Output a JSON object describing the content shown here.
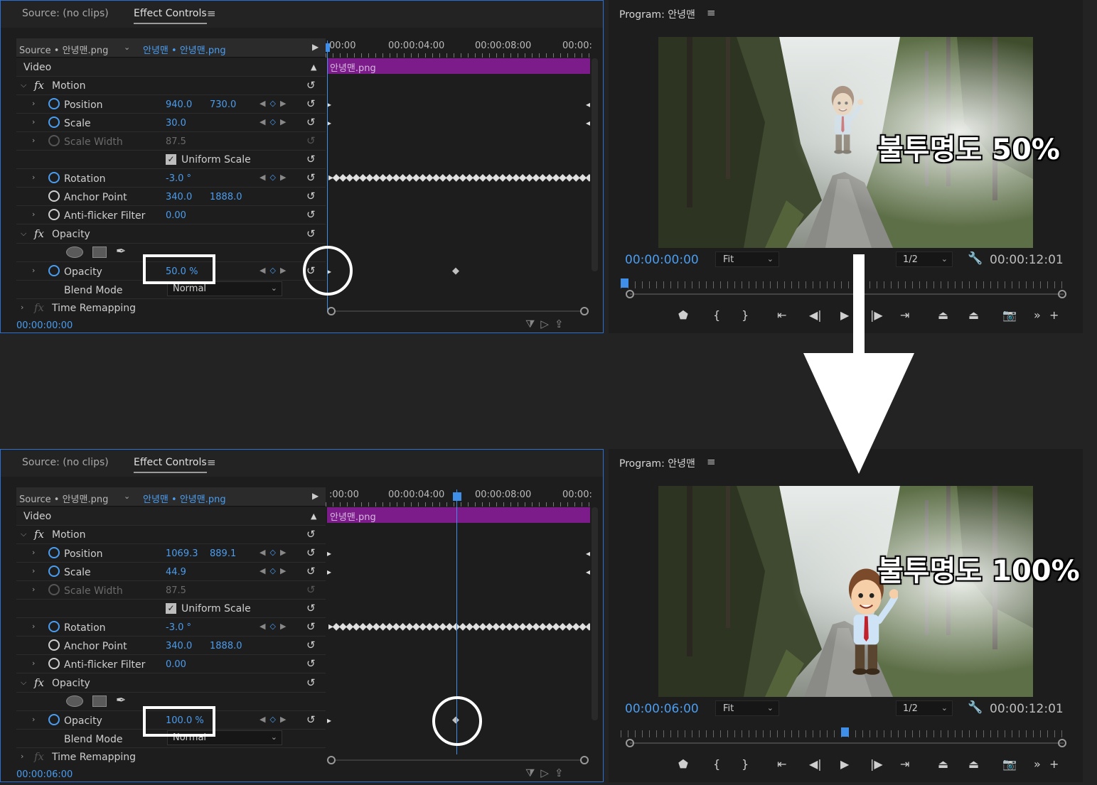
{
  "panels": [
    {
      "tabs": {
        "source": "Source: (no clips)",
        "effect_controls": "Effect Controls",
        "menu": "≡"
      },
      "header": {
        "source": "Source • 안녕맨.png",
        "clip": "안녕맨 • 안녕맨.png"
      },
      "ruler": [
        "00:00",
        "00:00:04:00",
        "00:00:08:00",
        "00:00:"
      ],
      "clip_name": "안녕맨.png",
      "video_label": "Video",
      "motion_label": "Motion",
      "position": {
        "label": "Position",
        "x": "940.0",
        "y": "730.0"
      },
      "scale": {
        "label": "Scale",
        "value": "30.0"
      },
      "scale_width": {
        "label": "Scale Width",
        "value": "87.5"
      },
      "uniform_scale": "Uniform Scale",
      "rotation": {
        "label": "Rotation",
        "value": "-3.0 °"
      },
      "anchor": {
        "label": "Anchor Point",
        "x": "340.0",
        "y": "1888.0"
      },
      "antiflicker": {
        "label": "Anti-flicker Filter",
        "value": "0.00"
      },
      "opacity_section": "Opacity",
      "opacity": {
        "label": "Opacity",
        "value": "50.0 %"
      },
      "blend": {
        "label": "Blend Mode",
        "value": "Normal"
      },
      "time_remap": "Time Remapping",
      "timecode": "00:00:00:00",
      "program": {
        "title": "Program: 안녕맨",
        "timecode": "00:00:00:00",
        "fit": "Fit",
        "resolution": "1/2",
        "duration": "00:00:12:01",
        "overlay": "불투명도 50%",
        "character_opacity": 0.5,
        "playhead_fraction": 0.0
      }
    },
    {
      "tabs": {
        "source": "Source: (no clips)",
        "effect_controls": "Effect Controls",
        "menu": "≡"
      },
      "header": {
        "source": "Source • 안녕맨.png",
        "clip": "안녕맨 • 안녕맨.png"
      },
      "ruler": [
        ":00:00",
        "00:00:04:00",
        "00:00:08:00",
        "00:00:"
      ],
      "clip_name": "안녕맨.png",
      "video_label": "Video",
      "motion_label": "Motion",
      "position": {
        "label": "Position",
        "x": "1069.3",
        "y": "889.1"
      },
      "scale": {
        "label": "Scale",
        "value": "44.9"
      },
      "scale_width": {
        "label": "Scale Width",
        "value": "87.5"
      },
      "uniform_scale": "Uniform Scale",
      "rotation": {
        "label": "Rotation",
        "value": "-3.0 °"
      },
      "anchor": {
        "label": "Anchor Point",
        "x": "340.0",
        "y": "1888.0"
      },
      "antiflicker": {
        "label": "Anti-flicker Filter",
        "value": "0.00"
      },
      "opacity_section": "Opacity",
      "opacity": {
        "label": "Opacity",
        "value": "100.0 %"
      },
      "blend": {
        "label": "Blend Mode",
        "value": "Normal"
      },
      "time_remap": "Time Remapping",
      "timecode": "00:00:06:00",
      "program": {
        "title": "Program: 안녕맨",
        "timecode": "00:00:06:00",
        "fit": "Fit",
        "resolution": "1/2",
        "duration": "00:00:12:01",
        "overlay": "불투명도 100%",
        "character_opacity": 1.0,
        "playhead_fraction": 0.5
      }
    }
  ],
  "icons": [
    "fx-icon",
    "stopwatch-icon",
    "reset-icon",
    "ellipse-mask-icon",
    "rectangle-mask-icon",
    "pen-mask-icon",
    "filter-icon",
    "wrench-icon",
    "marker-icon",
    "in-point-icon",
    "out-point-icon",
    "go-to-in-icon",
    "step-back-icon",
    "play-icon",
    "step-forward-icon",
    "go-to-out-icon",
    "lift-icon",
    "extract-icon",
    "camera-icon",
    "add-button-icon"
  ],
  "colors": {
    "accent": "#4a9df0",
    "clip": "#7b1c8a",
    "panel_border": "#2d6fd0"
  }
}
